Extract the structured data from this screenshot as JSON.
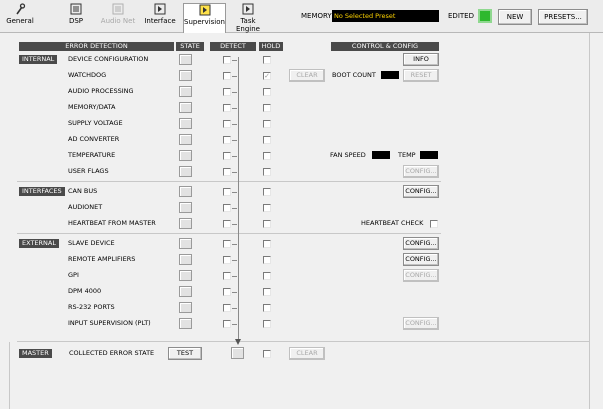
{
  "toolbar": {
    "tabs": [
      {
        "label": "General",
        "icon": "general-icon",
        "enabled": true
      },
      {
        "label": "DSP",
        "icon": "dsp-icon",
        "enabled": true
      },
      {
        "label": "Audio Net",
        "icon": "audionet-icon",
        "enabled": false
      },
      {
        "label": "Interface",
        "icon": "interface-icon",
        "enabled": true
      },
      {
        "label": "Supervision",
        "icon": "supervision-icon",
        "enabled": true,
        "active": true
      },
      {
        "label": "Task Engine",
        "icon": "task-engine-icon",
        "enabled": true
      }
    ],
    "memory_label": "MEMORY",
    "memory_value": "No Selected Preset",
    "edited_label": "EDITED",
    "edited_led_color": "#2eb82e",
    "new_label": "NEW",
    "presets_label": "PRESETS..."
  },
  "headers": {
    "error_detection": "ERROR DETECTION",
    "state": "STATE",
    "detect": "DETECT",
    "hold": "HOLD",
    "control_config": "CONTROL & CONFIG"
  },
  "sections": {
    "internal": "INTERNAL",
    "interfaces": "INTERFACES",
    "external": "EXTERNAL",
    "master": "MASTER"
  },
  "rows": [
    {
      "label": "DEVICE CONFIGURATION",
      "hold_checked": false
    },
    {
      "label": "WATCHDOG",
      "hold_checked": true
    },
    {
      "label": "AUDIO PROCESSING",
      "hold_checked": false
    },
    {
      "label": "MEMORY/DATA",
      "hold_checked": false
    },
    {
      "label": "SUPPLY VOLTAGE",
      "hold_checked": false
    },
    {
      "label": "AD CONVERTER",
      "hold_checked": false
    },
    {
      "label": "TEMPERATURE",
      "hold_checked": false
    },
    {
      "label": "USER FLAGS",
      "hold_checked": false
    },
    {
      "label": "CAN BUS",
      "hold_checked": false
    },
    {
      "label": "AUDIONET",
      "hold_checked": false
    },
    {
      "label": "HEARTBEAT FROM MASTER",
      "hold_checked": false
    },
    {
      "label": "SLAVE DEVICE",
      "hold_checked": false
    },
    {
      "label": "REMOTE AMPLIFIERS",
      "hold_checked": false
    },
    {
      "label": "GPI",
      "hold_checked": false
    },
    {
      "label": "DPM 4000",
      "hold_checked": false
    },
    {
      "label": "RS-232 PORTS",
      "hold_checked": false
    },
    {
      "label": "INPUT SUPERVISION (PLT)",
      "hold_checked": false
    }
  ],
  "controls": {
    "info": "INFO",
    "clear": "CLEAR",
    "boot_count": "BOOT COUNT",
    "reset": "RESET",
    "fan_speed": "FAN SPEED",
    "temp": "TEMP",
    "config": "CONFIG...",
    "heartbeat_check": "HEARTBEAT CHECK"
  },
  "master": {
    "label": "COLLECTED ERROR STATE",
    "test": "TEST",
    "clear": "CLEAR"
  }
}
